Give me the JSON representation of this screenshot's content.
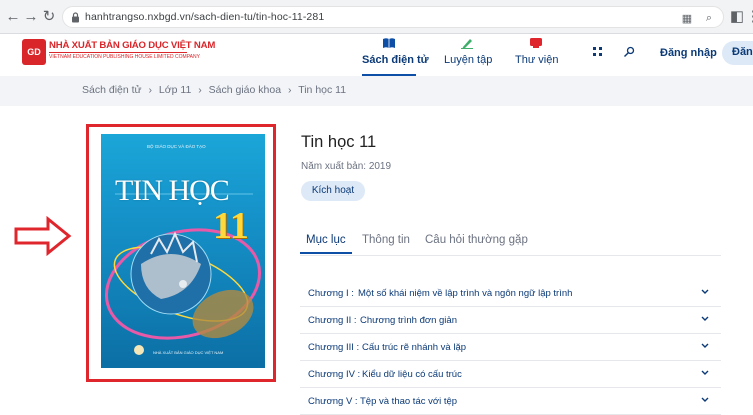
{
  "browser": {
    "url": "hanhtrangso.nxbgd.vn/sach-dien-tu/tin-hoc-11-281"
  },
  "header": {
    "logo_title": "NHÀ XUẤT BẢN GIÁO DỤC VIỆT NAM",
    "logo_subtitle": "VIETNAM EDUCATION PUBLISHING HOUSE LIMITED COMPANY",
    "logo_badge": "GD",
    "nav": [
      {
        "label": "Sách điện tử",
        "active": true,
        "color": "#0d4ea6"
      },
      {
        "label": "Luyện tập",
        "active": false,
        "color": "#3fae6b"
      },
      {
        "label": "Thư viện",
        "active": false,
        "color": "#e0262d"
      }
    ],
    "login": "Đăng nhập",
    "register": "Đăn"
  },
  "breadcrumb": [
    "Sách điện tử",
    "Lớp 11",
    "Sách giáo khoa",
    "Tin học 11"
  ],
  "book": {
    "cover_publisher": "BỘ GIÁO DỤC VÀ ĐÀO TẠO",
    "cover_title": "TIN HỌC",
    "cover_number": "11",
    "cover_bottom": "NHÀ XUẤT BẢN GIÁO DỤC VIỆT NAM",
    "title": "Tin học 11",
    "year": "Năm xuất bản: 2019",
    "activate": "Kích hoạt"
  },
  "tabs": [
    "Mục lục",
    "Thông tin",
    "Câu hỏi thường gặp"
  ],
  "chapters": [
    {
      "num": "Chương I :",
      "name": "Một số khái niệm về lập trình và ngôn ngữ lập trình"
    },
    {
      "num": "Chương II :",
      "name": "Chương trình đơn giản"
    },
    {
      "num": "Chương III :",
      "name": "Cấu trúc rẽ nhánh và lặp"
    },
    {
      "num": "Chương IV :",
      "name": "Kiểu dữ liệu có cấu trúc"
    },
    {
      "num": "Chương V :",
      "name": "Tệp và thao tác với tệp"
    }
  ],
  "colors": {
    "primary": "#0b3a77",
    "accent": "#0d4ea6",
    "annotation": "#e0262d"
  }
}
